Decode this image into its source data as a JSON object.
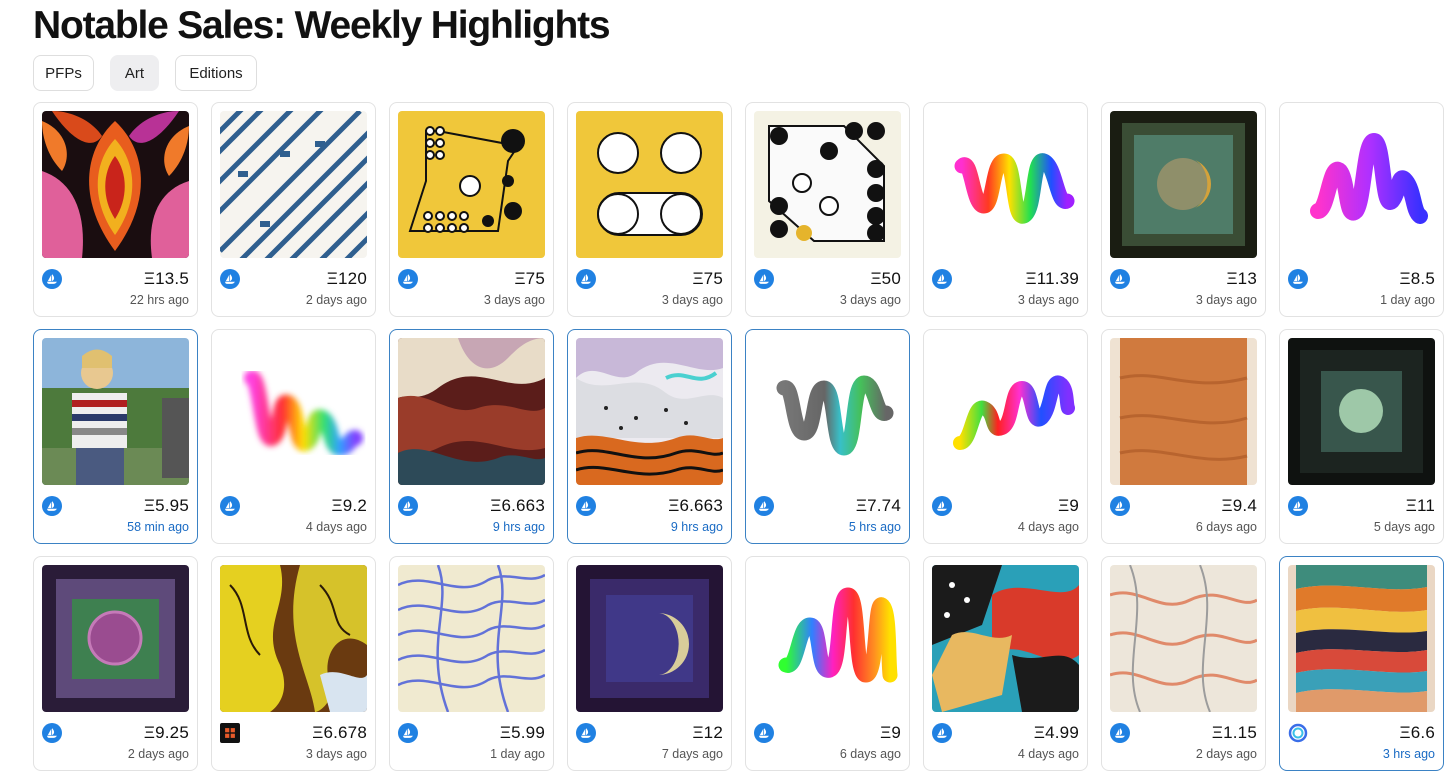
{
  "title": "Notable Sales: Weekly Highlights",
  "tabs": [
    {
      "label": "PFPs",
      "active": false
    },
    {
      "label": "Art",
      "active": true
    },
    {
      "label": "Editions",
      "active": false
    }
  ],
  "cards": [
    {
      "price": "Ξ13.5",
      "time": "22 hrs ago",
      "marketplace": "opensea-icon",
      "art": "flower"
    },
    {
      "price": "Ξ120",
      "time": "2 days ago",
      "marketplace": "opensea-icon",
      "art": "diagonal"
    },
    {
      "price": "Ξ75",
      "time": "3 days ago",
      "marketplace": "opensea-icon",
      "art": "dots-yellow"
    },
    {
      "price": "Ξ75",
      "time": "3 days ago",
      "marketplace": "opensea-icon",
      "art": "circles-yellow"
    },
    {
      "price": "Ξ50",
      "time": "3 days ago",
      "marketplace": "opensea-icon",
      "art": "dots-cream"
    },
    {
      "price": "Ξ11.39",
      "time": "3 days ago",
      "marketplace": "opensea-icon",
      "art": "squiggle-rainbow"
    },
    {
      "price": "Ξ13",
      "time": "3 days ago",
      "marketplace": "opensea-icon",
      "art": "moon-green"
    },
    {
      "price": "Ξ8.5",
      "time": "1 day ago",
      "marketplace": "opensea-icon",
      "art": "squiggle-magenta"
    },
    {
      "price": "Ξ5.95",
      "time": "58 min ago",
      "marketplace": "opensea-icon",
      "art": "photo",
      "recent": true
    },
    {
      "price": "Ξ9.2",
      "time": "4 days ago",
      "marketplace": "opensea-icon",
      "art": "squiggle-soft"
    },
    {
      "price": "Ξ6.663",
      "time": "9 hrs ago",
      "marketplace": "opensea-icon",
      "art": "folds-warm",
      "recent": true
    },
    {
      "price": "Ξ6.663",
      "time": "9 hrs ago",
      "marketplace": "opensea-icon",
      "art": "folds-cool",
      "recent": true
    },
    {
      "price": "Ξ7.74",
      "time": "5 hrs ago",
      "marketplace": "opensea-icon",
      "art": "squiggle-gray",
      "recent": true
    },
    {
      "price": "Ξ9",
      "time": "4 days ago",
      "marketplace": "opensea-icon",
      "art": "squiggle-rainbow2"
    },
    {
      "price": "Ξ9.4",
      "time": "6 days ago",
      "marketplace": "opensea-icon",
      "art": "sand"
    },
    {
      "price": "Ξ11",
      "time": "5 days ago",
      "marketplace": "opensea-icon",
      "art": "moon-dark"
    },
    {
      "price": "Ξ9.25",
      "time": "2 days ago",
      "marketplace": "opensea-icon",
      "art": "moon-purple"
    },
    {
      "price": "Ξ6.678",
      "time": "3 days ago",
      "marketplace": "objkt-icon",
      "art": "folds-yellow"
    },
    {
      "price": "Ξ5.99",
      "time": "1 day ago",
      "marketplace": "opensea-icon",
      "art": "marble-blue"
    },
    {
      "price": "Ξ12",
      "time": "7 days ago",
      "marketplace": "opensea-icon",
      "art": "moon-crescent"
    },
    {
      "price": "Ξ9",
      "time": "6 days ago",
      "marketplace": "opensea-icon",
      "art": "squiggle-rainbow3"
    },
    {
      "price": "Ξ4.99",
      "time": "4 days ago",
      "marketplace": "opensea-icon",
      "art": "abstract"
    },
    {
      "price": "Ξ1.15",
      "time": "2 days ago",
      "marketplace": "opensea-icon",
      "art": "marble-peach"
    },
    {
      "price": "Ξ6.6",
      "time": "3 hrs ago",
      "marketplace": "ring-icon",
      "art": "stripes",
      "recent": true
    }
  ]
}
